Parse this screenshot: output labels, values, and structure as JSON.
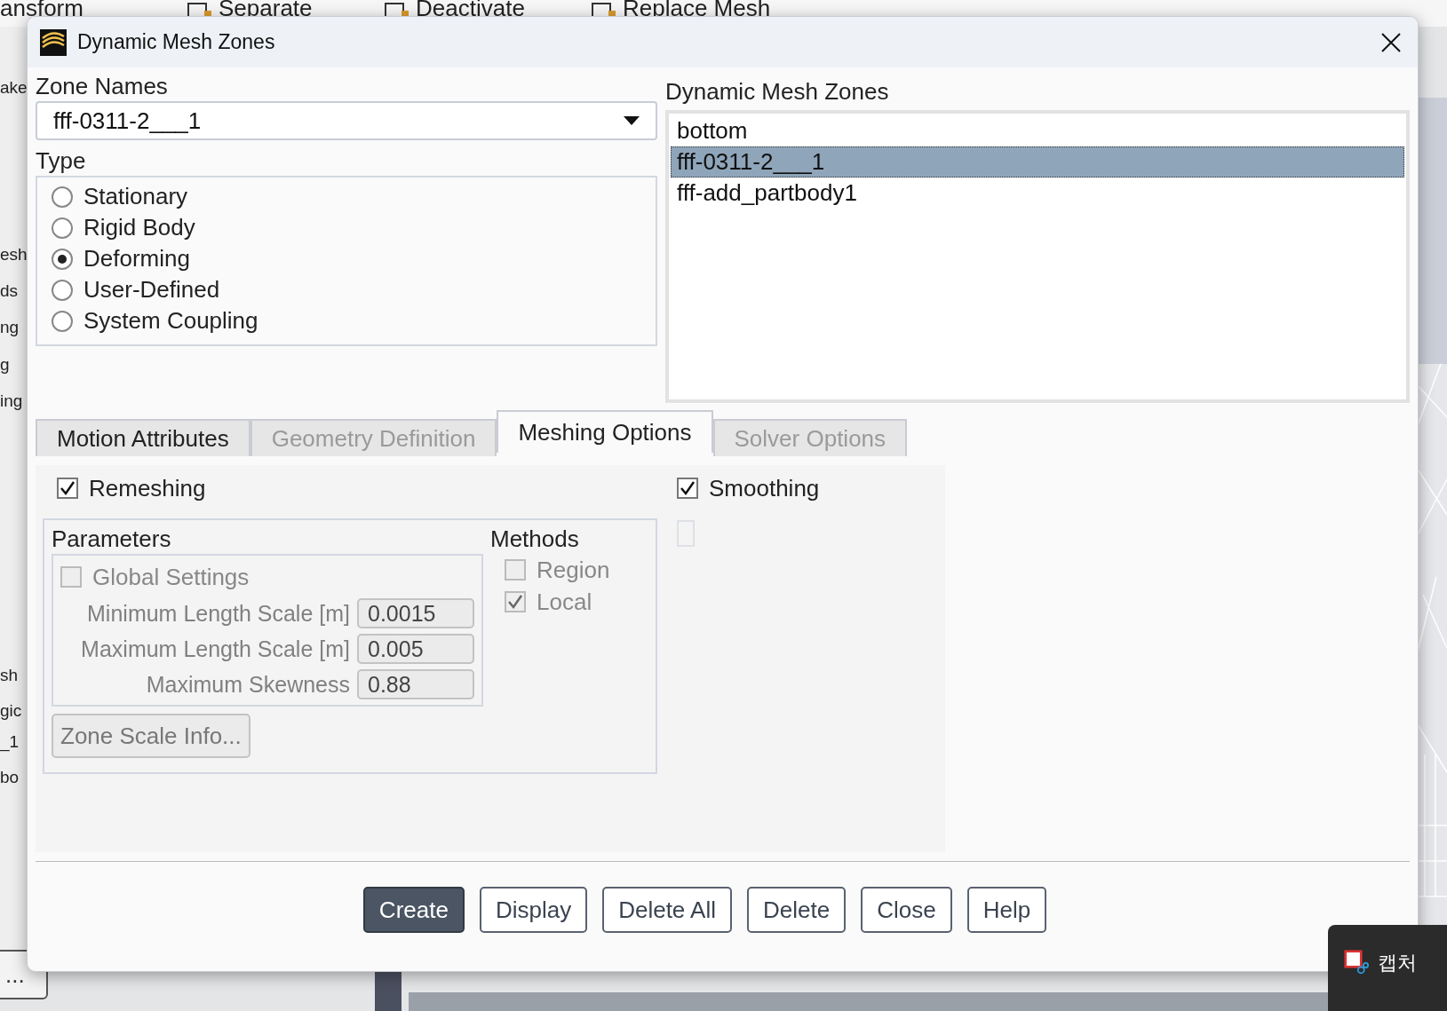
{
  "background": {
    "toolbar_items": [
      "ansform",
      "Separate",
      "Deactivate",
      "Replace Mesh"
    ],
    "side_fragments": [
      "ake",
      "esh",
      "ds",
      "ng",
      "g",
      "ing",
      "sh",
      "gic",
      "_1",
      "bo"
    ],
    "bottom_buttons": [
      "..."
    ]
  },
  "dialog": {
    "title": "Dynamic Mesh Zones",
    "zone_names": {
      "label": "Zone Names",
      "value": "fff-0311-2___1"
    },
    "type": {
      "label": "Type",
      "options": [
        {
          "label": "Stationary",
          "selected": false
        },
        {
          "label": "Rigid Body",
          "selected": false
        },
        {
          "label": "Deforming",
          "selected": true
        },
        {
          "label": "User-Defined",
          "selected": false
        },
        {
          "label": "System Coupling",
          "selected": false
        }
      ]
    },
    "zones_list": {
      "label": "Dynamic Mesh Zones",
      "items": [
        {
          "label": "bottom",
          "selected": false
        },
        {
          "label": "fff-0311-2___1",
          "selected": true
        },
        {
          "label": "fff-add_partbody1",
          "selected": false
        }
      ]
    },
    "tabs": [
      {
        "label": "Motion Attributes",
        "selected": false,
        "disabled": false
      },
      {
        "label": "Geometry Definition",
        "selected": false,
        "disabled": true
      },
      {
        "label": "Meshing Options",
        "selected": true,
        "disabled": false
      },
      {
        "label": "Solver Options",
        "selected": false,
        "disabled": true
      }
    ],
    "meshing": {
      "remeshing": {
        "label": "Remeshing",
        "checked": true
      },
      "smoothing": {
        "label": "Smoothing",
        "checked": true
      },
      "parameters": {
        "label": "Parameters",
        "global_settings": {
          "label": "Global Settings",
          "checked": false,
          "disabled": true
        },
        "fields": [
          {
            "label": "Minimum Length Scale [m]",
            "value": "0.0015",
            "disabled": true
          },
          {
            "label": "Maximum Length Scale [m]",
            "value": "0.005",
            "disabled": true
          },
          {
            "label": "Maximum Skewness",
            "value": "0.88",
            "disabled": true
          }
        ],
        "button": {
          "label": "Zone Scale Info...",
          "disabled": true
        }
      },
      "methods": {
        "label": "Methods",
        "options": [
          {
            "label": "Region",
            "checked": false,
            "disabled": true
          },
          {
            "label": "Local",
            "checked": true,
            "disabled": true
          }
        ]
      }
    },
    "buttons": [
      {
        "label": "Create",
        "primary": true
      },
      {
        "label": "Display",
        "primary": false
      },
      {
        "label": "Delete All",
        "primary": false
      },
      {
        "label": "Delete",
        "primary": false
      },
      {
        "label": "Close",
        "primary": false
      },
      {
        "label": "Help",
        "primary": false
      }
    ]
  },
  "taskbar_popup": {
    "label": "캡처"
  }
}
